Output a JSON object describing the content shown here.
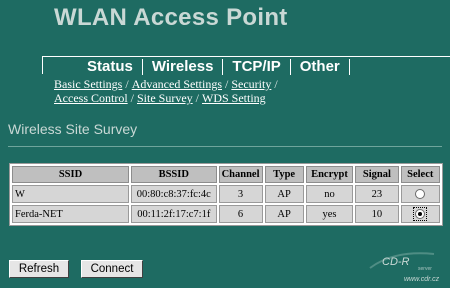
{
  "header": {
    "title": "WLAN Access Point"
  },
  "tabs": [
    "Status",
    "Wireless",
    "TCP/IP",
    "Other"
  ],
  "sublinks": {
    "row1": [
      "Basic Settings",
      "Advanced Settings",
      "Security"
    ],
    "row2": [
      "Access Control",
      "Site Survey",
      "WDS Setting"
    ],
    "separator": "/"
  },
  "section": {
    "title": "Wireless Site Survey"
  },
  "table": {
    "columns": [
      "SSID",
      "BSSID",
      "Channel",
      "Type",
      "Encrypt",
      "Signal",
      "Select"
    ],
    "rows": [
      {
        "ssid": "W",
        "bssid": "00:80:c8:37:fc:4c",
        "channel": "3",
        "type": "AP",
        "encrypt": "no",
        "signal": "23",
        "selected": false
      },
      {
        "ssid": "Ferda-NET",
        "bssid": "00:11:2f:17:c7:1f",
        "channel": "6",
        "type": "AP",
        "encrypt": "yes",
        "signal": "10",
        "selected": true
      }
    ]
  },
  "buttons": {
    "refresh": "Refresh",
    "connect": "Connect"
  },
  "watermark": {
    "text": "CD-R",
    "sub": "server",
    "url": "www.cdr.cz"
  },
  "colors": {
    "background": "#1e6b62",
    "title": "#c9d8d5",
    "table_cell": "#d6d6d6"
  }
}
